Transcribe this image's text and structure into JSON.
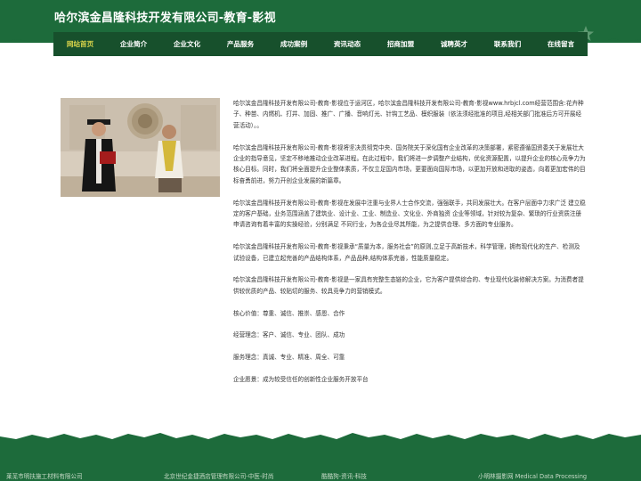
{
  "header": {
    "title": "哈尔滨金昌隆科技开发有限公司-教育-影视"
  },
  "nav": {
    "items": [
      {
        "label": "网站首页",
        "active": true
      },
      {
        "label": "企业简介"
      },
      {
        "label": "企业文化"
      },
      {
        "label": "产品服务"
      },
      {
        "label": "成功案例"
      },
      {
        "label": "资讯动态"
      },
      {
        "label": "招商加盟"
      },
      {
        "label": "诚聘英才"
      },
      {
        "label": "联系我们"
      },
      {
        "label": "在线留言"
      }
    ]
  },
  "content": {
    "paragraphs": [
      "哈尔滨金昌隆科技开发有限公司-教育-影视位于运河区，哈尔滨金昌隆科技开发有限公司-教育-影视www.hrbjcl.com经营范围含:花卉种子、种苗、内燃机、打井、加固、推广、广播、音响灯光、针钩工艺品、模织服装（依法须经批准的项目,经相关部门批准后方可开展经营活动）。。",
      "哈尔滨金昌隆科技开发有限公司-教育-影视将坚决贯彻党中央、国务院关于深化国有企业改革的决策部署，紧密遵循国资委关于发展壮大企业的指导意见，坚定不移地推动企业改革进程。在此过程中，我们将进一步调整产业结构，优化资源配置，以提升企业的核心竞争力为核心目标。同时，我们将全面提升企业整体素质，不仅立足国内市场，更要面向国际市场，以更加开放和进取的姿态，向着更加宏伟的目标奋勇前进，努力开创企业发展的新篇章。",
      "哈尔滨金昌隆科技开发有限公司-教育-影视在发展中注重与业界人士合作交流，强强联手，共同发展壮大。在客户层面中力求广泛 建立稳定的客户基础，业务范围涵盖了建筑业、设计业、工业、制造业、文化业、外商独资 企业等领域，针对较为复杂、繁琐的行业资质注册申请咨询有着丰富的实操经验，分别满足 不同行业，为各企业尽其所能，为之提供合理、多方面的专业服务。",
      "哈尔滨金昌隆科技开发有限公司-教育-影视秉承“质量为本，服务社会”的原则,立足于高新技术，科学管理，拥有现代化的生产、检测及试验设备，已建立起完善的产品结构体系，产品品种,结构体系完善，性能质量稳定。",
      "哈尔滨金昌隆科技开发有限公司-教育-影视是一家具有完整生态链的企业，它为客户提供综合的、专业现代化装修解决方案。为消费者提供较优质的产品、较贴切的服务、较具竞争力的营销模式。",
      "核心价值：尊重、诚信、推崇、感恩、合作",
      "经营理念：客户、诚信、专业、团队、成功",
      "服务理念：真诚、专业、精准、周全、可靠",
      "企业愿景：成为较受信任的创新性企业服务开放平台"
    ]
  },
  "footer": {
    "links": [
      "莱芜市明扶施工材料有限公司",
      "北京世纪金捷酒店管理有限公司-中医-时尚",
      "酷酷狗-资讯-科技",
      "小明林摄影网 Medical Data Processing"
    ]
  },
  "colors": {
    "brand_green": "#1d6b3b",
    "nav_green": "#17502c",
    "active_nav": "#d7d24a"
  }
}
